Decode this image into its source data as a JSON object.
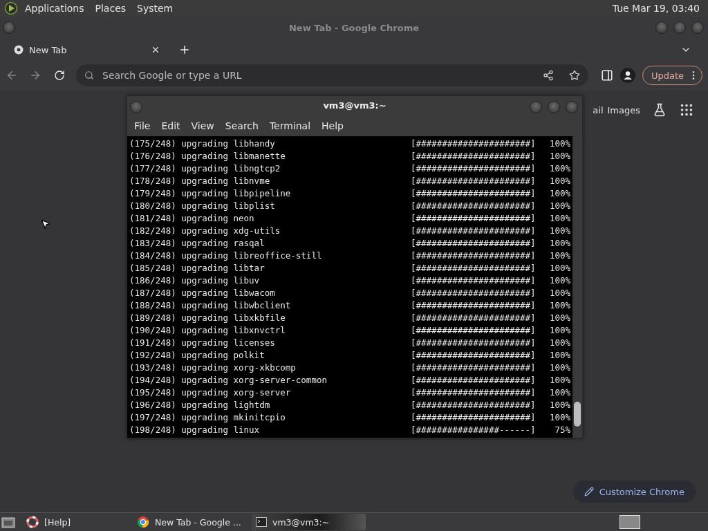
{
  "top_panel": {
    "menus": [
      "Applications",
      "Places",
      "System"
    ],
    "clock": "Tue Mar 19, 03:40"
  },
  "browser": {
    "title": "New Tab - Google Chrome",
    "tabs": [
      {
        "label": "New Tab",
        "selected": true
      }
    ],
    "address": {
      "placeholder": "Search Google or type a URL"
    },
    "update_button": "Update",
    "links": [
      "ail",
      "Images"
    ],
    "customize_button": "Customize Chrome"
  },
  "terminal": {
    "title": "vm3@vm3:~",
    "menus": [
      "File",
      "Edit",
      "View",
      "Search",
      "Terminal",
      "Help"
    ],
    "lines": [
      {
        "text": "(175/248) upgrading libhandy",
        "bar": "[######################]",
        "percent": "100%"
      },
      {
        "text": "(176/248) upgrading libmanette",
        "bar": "[######################]",
        "percent": "100%"
      },
      {
        "text": "(177/248) upgrading libngtcp2",
        "bar": "[######################]",
        "percent": "100%"
      },
      {
        "text": "(178/248) upgrading libnvme",
        "bar": "[######################]",
        "percent": "100%"
      },
      {
        "text": "(179/248) upgrading libpipeline",
        "bar": "[######################]",
        "percent": "100%"
      },
      {
        "text": "(180/248) upgrading libplist",
        "bar": "[######################]",
        "percent": "100%"
      },
      {
        "text": "(181/248) upgrading neon",
        "bar": "[######################]",
        "percent": "100%"
      },
      {
        "text": "(182/248) upgrading xdg-utils",
        "bar": "[######################]",
        "percent": "100%"
      },
      {
        "text": "(183/248) upgrading rasqal",
        "bar": "[######################]",
        "percent": "100%"
      },
      {
        "text": "(184/248) upgrading libreoffice-still",
        "bar": "[######################]",
        "percent": "100%"
      },
      {
        "text": "(185/248) upgrading libtar",
        "bar": "[######################]",
        "percent": "100%"
      },
      {
        "text": "(186/248) upgrading libuv",
        "bar": "[######################]",
        "percent": "100%"
      },
      {
        "text": "(187/248) upgrading libwacom",
        "bar": "[######################]",
        "percent": "100%"
      },
      {
        "text": "(188/248) upgrading libwbclient",
        "bar": "[######################]",
        "percent": "100%"
      },
      {
        "text": "(189/248) upgrading libxkbfile",
        "bar": "[######################]",
        "percent": "100%"
      },
      {
        "text": "(190/248) upgrading libxnvctrl",
        "bar": "[######################]",
        "percent": "100%"
      },
      {
        "text": "(191/248) upgrading licenses",
        "bar": "[######################]",
        "percent": "100%"
      },
      {
        "text": "(192/248) upgrading polkit",
        "bar": "[######################]",
        "percent": "100%"
      },
      {
        "text": "(193/248) upgrading xorg-xkbcomp",
        "bar": "[######################]",
        "percent": "100%"
      },
      {
        "text": "(194/248) upgrading xorg-server-common",
        "bar": "[######################]",
        "percent": "100%"
      },
      {
        "text": "(195/248) upgrading xorg-server",
        "bar": "[######################]",
        "percent": "100%"
      },
      {
        "text": "(196/248) upgrading lightdm",
        "bar": "[######################]",
        "percent": "100%"
      },
      {
        "text": "(197/248) upgrading mkinitcpio",
        "bar": "[######################]",
        "percent": "100%"
      },
      {
        "text": "(198/248) upgrading linux",
        "bar": "[################------]",
        "percent": "75%"
      }
    ]
  },
  "taskbar": {
    "items": [
      {
        "label": "[Help]",
        "kind": "help",
        "selected": false
      },
      {
        "label": "New Tab - Google ...",
        "kind": "browser",
        "selected": false
      },
      {
        "label": "vm3@vm3:~",
        "kind": "terminal",
        "selected": true
      }
    ]
  }
}
